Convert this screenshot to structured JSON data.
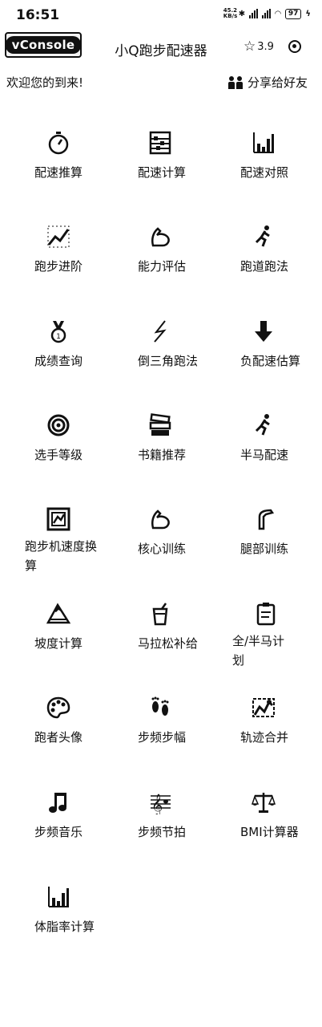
{
  "status_bar": {
    "time": "16:51",
    "net_speed": "45.2 KB/s",
    "battery": "97"
  },
  "nav": {
    "vconsole_label": "vConsole",
    "title": "小Q跑步配速器",
    "rating": "3.9"
  },
  "welcome_text": "欢迎您的到来!",
  "share_text": "分享给好友",
  "tools": [
    {
      "label": "配速推算",
      "icon": "stopwatch-icon"
    },
    {
      "label": "配速计算",
      "icon": "abacus-icon"
    },
    {
      "label": "配速对照",
      "icon": "bar-chart-icon"
    },
    {
      "label": "跑步进阶",
      "icon": "trend-up-icon"
    },
    {
      "label": "能力评估",
      "icon": "flexed-biceps-icon"
    },
    {
      "label": "跑道跑法",
      "icon": "runner-icon"
    },
    {
      "label": "成绩查询",
      "icon": "medal-icon"
    },
    {
      "label": "倒三角跑法",
      "icon": "lightning-icon"
    },
    {
      "label": "负配速估算",
      "icon": "down-arrow-icon"
    },
    {
      "label": "选手等级",
      "icon": "target-icon"
    },
    {
      "label": "书籍推荐",
      "icon": "books-icon"
    },
    {
      "label": "半马配速",
      "icon": "runner-icon"
    },
    {
      "label": "跑步机速度换算",
      "icon": "treadmill-icon"
    },
    {
      "label": "核心训练",
      "icon": "flexed-biceps-icon"
    },
    {
      "label": "腿部训练",
      "icon": "leg-icon"
    },
    {
      "label": "坡度计算",
      "icon": "mountain-icon"
    },
    {
      "label": "马拉松补给",
      "icon": "cup-icon"
    },
    {
      "label": "全/半马计划",
      "icon": "clipboard-icon"
    },
    {
      "label": "跑者头像",
      "icon": "palette-icon"
    },
    {
      "label": "步频步幅",
      "icon": "footprints-icon"
    },
    {
      "label": "轨迹合并",
      "icon": "map-icon"
    },
    {
      "label": "步频音乐",
      "icon": "music-note-icon"
    },
    {
      "label": "步频节拍",
      "icon": "music-score-icon"
    },
    {
      "label": "BMI计算器",
      "icon": "scales-icon"
    },
    {
      "label": "体脂率计算",
      "icon": "bar-chart-icon"
    }
  ]
}
